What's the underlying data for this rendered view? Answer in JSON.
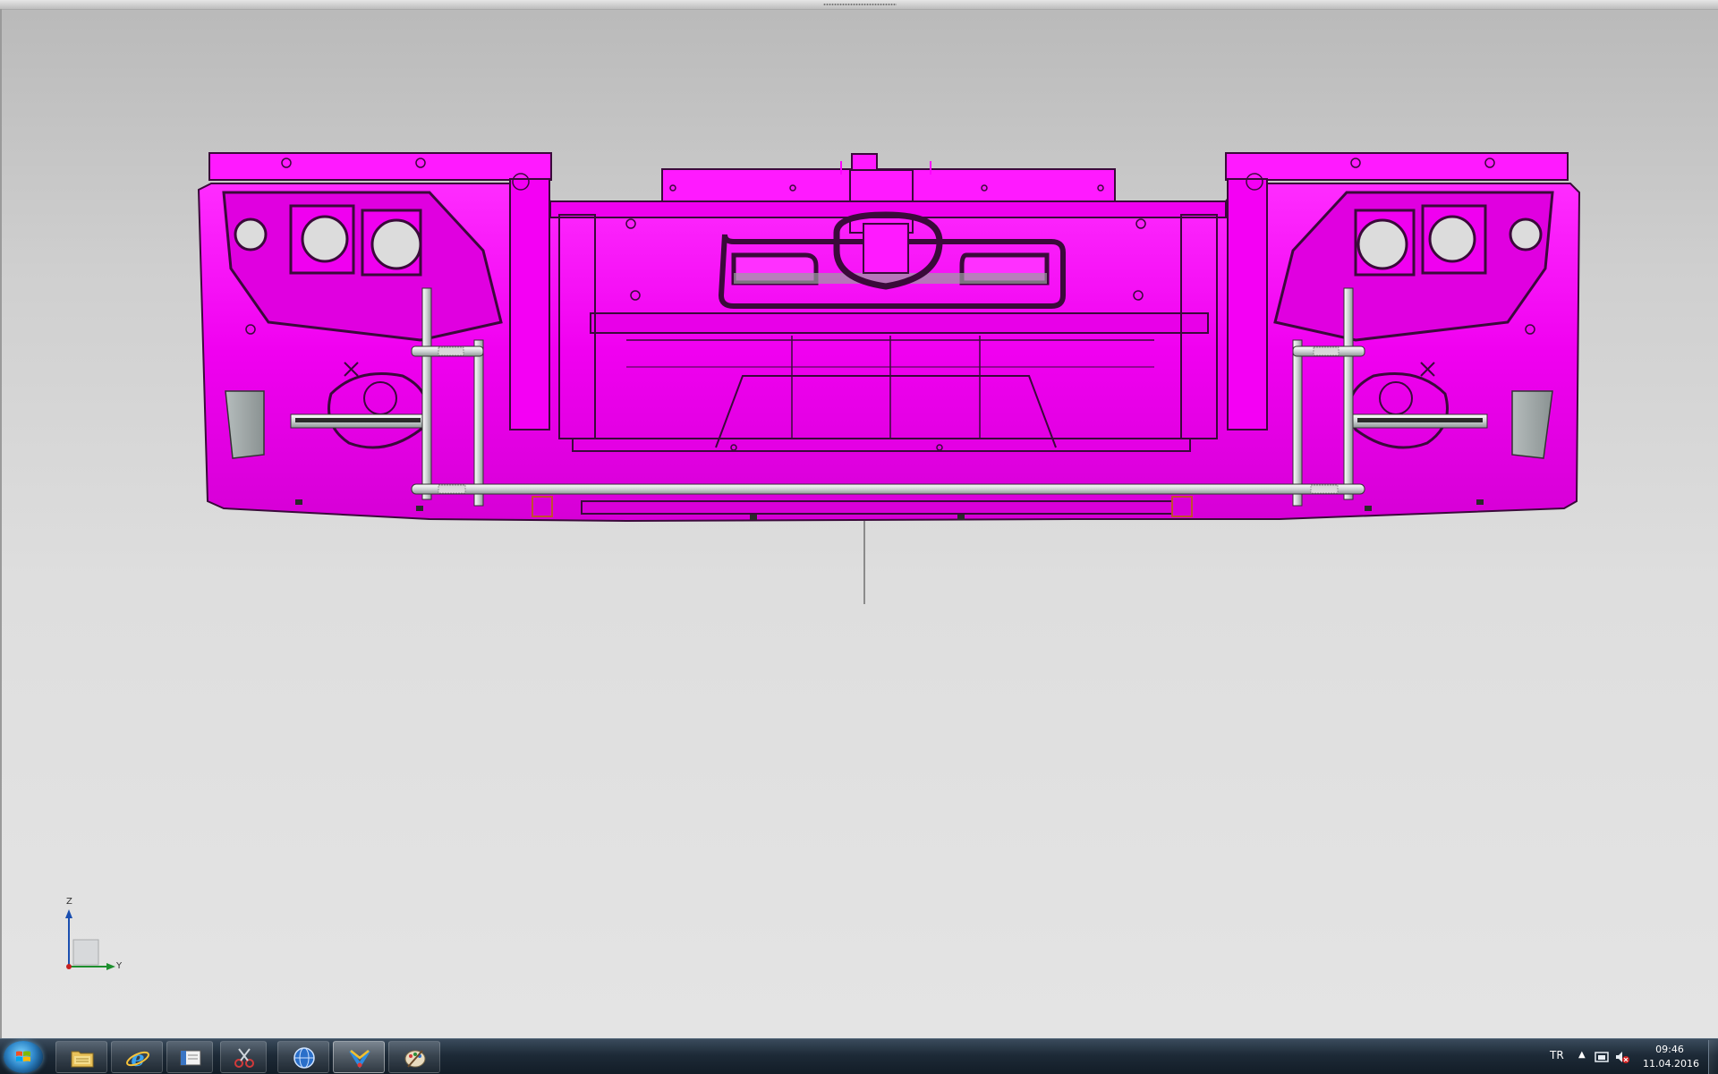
{
  "viewport": {
    "triad": {
      "z_label": "Z",
      "y_label": "Y"
    }
  },
  "colors": {
    "body": "#ff00ff",
    "body_dark": "#c800c8",
    "edge": "#3a0a3a",
    "metal": "#d8dcdc",
    "background_top": "#b9b9b9",
    "background_bottom": "#e4e4e4"
  },
  "taskbar": {
    "start": {
      "icon": "windows-orb-icon"
    },
    "pinned": [
      {
        "name": "file-explorer",
        "icon": "folder-icon",
        "active": false
      },
      {
        "name": "internet-explorer",
        "icon": "ie-icon",
        "active": false
      },
      {
        "name": "app-window",
        "icon": "window-icon",
        "active": false
      },
      {
        "name": "snipping-tool",
        "icon": "scissors-icon",
        "active": false
      },
      {
        "name": "web-browser",
        "icon": "globe-icon",
        "active": false
      },
      {
        "name": "cad-application",
        "icon": "cad-app-icon",
        "active": true
      },
      {
        "name": "paint",
        "icon": "paint-icon",
        "active": false
      }
    ],
    "tray": {
      "language": "TR",
      "time": "09:46",
      "date": "11.04.2016"
    }
  }
}
